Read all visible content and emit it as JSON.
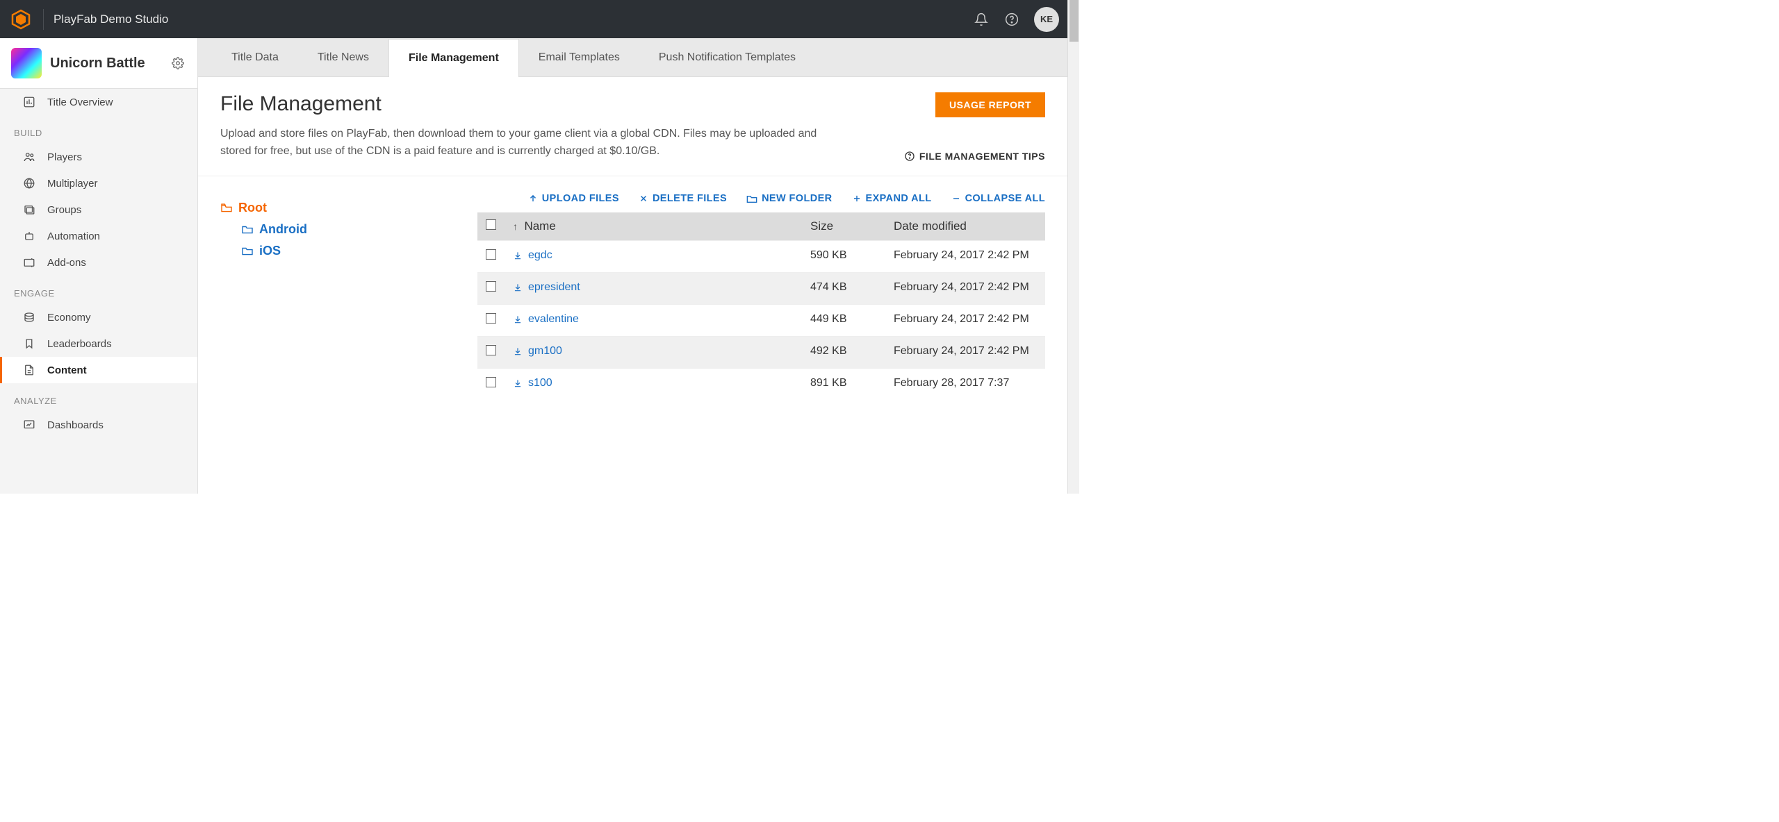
{
  "header": {
    "studio_name": "PlayFab Demo Studio",
    "avatar_initials": "KE"
  },
  "title": {
    "name": "Unicorn Battle"
  },
  "sidebar": {
    "item_overview": "Title Overview",
    "section_build": "BUILD",
    "item_players": "Players",
    "item_multiplayer": "Multiplayer",
    "item_groups": "Groups",
    "item_automation": "Automation",
    "item_addons": "Add-ons",
    "section_engage": "ENGAGE",
    "item_economy": "Economy",
    "item_leaderboards": "Leaderboards",
    "item_content": "Content",
    "section_analyze": "ANALYZE",
    "item_dashboards": "Dashboards"
  },
  "tabs": {
    "title_data": "Title Data",
    "title_news": "Title News",
    "file_management": "File Management",
    "email_templates": "Email Templates",
    "push_templates": "Push Notification Templates"
  },
  "page": {
    "title": "File Management",
    "description": "Upload and store files on PlayFab, then download them to your game client via a global CDN. Files may be uploaded and stored for free, but use of the CDN is a paid feature and is currently charged at $0.10/GB.",
    "usage_button": "USAGE REPORT",
    "tips_link": "FILE MANAGEMENT TIPS"
  },
  "tree": {
    "root": "Root",
    "android": "Android",
    "ios": "iOS"
  },
  "toolbar": {
    "upload": "UPLOAD FILES",
    "delete": "DELETE FILES",
    "new_folder": "NEW FOLDER",
    "expand": "EXPAND ALL",
    "collapse": "COLLAPSE ALL"
  },
  "table": {
    "col_name": "Name",
    "col_size": "Size",
    "col_date": "Date modified",
    "rows": [
      {
        "name": "egdc",
        "size": "590 KB",
        "date": "February 24, 2017 2:42 PM"
      },
      {
        "name": "epresident",
        "size": "474 KB",
        "date": "February 24, 2017 2:42 PM"
      },
      {
        "name": "evalentine",
        "size": "449 KB",
        "date": "February 24, 2017 2:42 PM"
      },
      {
        "name": "gm100",
        "size": "492 KB",
        "date": "February 24, 2017 2:42 PM"
      },
      {
        "name": "s100",
        "size": "891 KB",
        "date": "February 28, 2017 7:37"
      }
    ]
  }
}
